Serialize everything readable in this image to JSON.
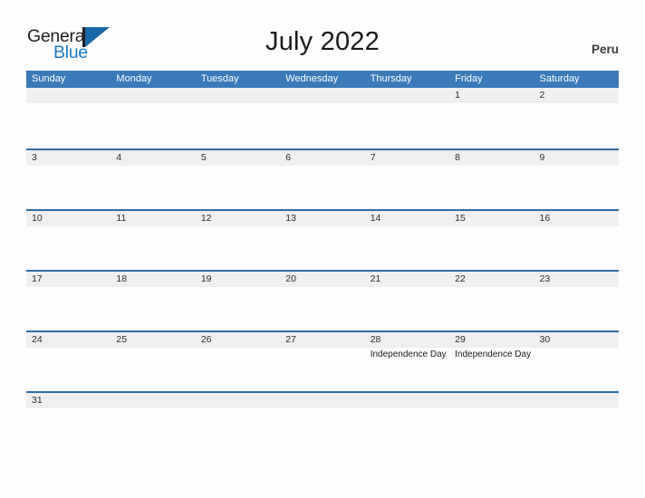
{
  "logo": {
    "word_one": "General",
    "word_two": "Blue",
    "flag_icon": "flag-triangle-icon",
    "colors": {
      "general": "#231F20",
      "blue": "#1F7AC4",
      "flag": "#1668A8"
    }
  },
  "header": {
    "title": "July 2022",
    "country": "Peru"
  },
  "theme": {
    "header_blue": "#3B79B8",
    "divider_blue": "#2E6DA4",
    "band_gray": "#EFEFEF",
    "page_background": "#FDFDFD"
  },
  "calendar": {
    "day_names": [
      "Sunday",
      "Monday",
      "Tuesday",
      "Wednesday",
      "Thursday",
      "Friday",
      "Saturday"
    ],
    "weeks": [
      [
        {
          "day": "",
          "events": []
        },
        {
          "day": "",
          "events": []
        },
        {
          "day": "",
          "events": []
        },
        {
          "day": "",
          "events": []
        },
        {
          "day": "",
          "events": []
        },
        {
          "day": "1",
          "events": []
        },
        {
          "day": "2",
          "events": []
        }
      ],
      [
        {
          "day": "3",
          "events": []
        },
        {
          "day": "4",
          "events": []
        },
        {
          "day": "5",
          "events": []
        },
        {
          "day": "6",
          "events": []
        },
        {
          "day": "7",
          "events": []
        },
        {
          "day": "8",
          "events": []
        },
        {
          "day": "9",
          "events": []
        }
      ],
      [
        {
          "day": "10",
          "events": []
        },
        {
          "day": "11",
          "events": []
        },
        {
          "day": "12",
          "events": []
        },
        {
          "day": "13",
          "events": []
        },
        {
          "day": "14",
          "events": []
        },
        {
          "day": "15",
          "events": []
        },
        {
          "day": "16",
          "events": []
        }
      ],
      [
        {
          "day": "17",
          "events": []
        },
        {
          "day": "18",
          "events": []
        },
        {
          "day": "19",
          "events": []
        },
        {
          "day": "20",
          "events": []
        },
        {
          "day": "21",
          "events": []
        },
        {
          "day": "22",
          "events": []
        },
        {
          "day": "23",
          "events": []
        }
      ],
      [
        {
          "day": "24",
          "events": []
        },
        {
          "day": "25",
          "events": []
        },
        {
          "day": "26",
          "events": []
        },
        {
          "day": "27",
          "events": []
        },
        {
          "day": "28",
          "events": [
            "Independence Day"
          ]
        },
        {
          "day": "29",
          "events": [
            "Independence Day"
          ]
        },
        {
          "day": "30",
          "events": []
        }
      ],
      [
        {
          "day": "31",
          "events": []
        },
        {
          "day": "",
          "events": []
        },
        {
          "day": "",
          "events": []
        },
        {
          "day": "",
          "events": []
        },
        {
          "day": "",
          "events": []
        },
        {
          "day": "",
          "events": []
        },
        {
          "day": "",
          "events": []
        }
      ]
    ]
  }
}
